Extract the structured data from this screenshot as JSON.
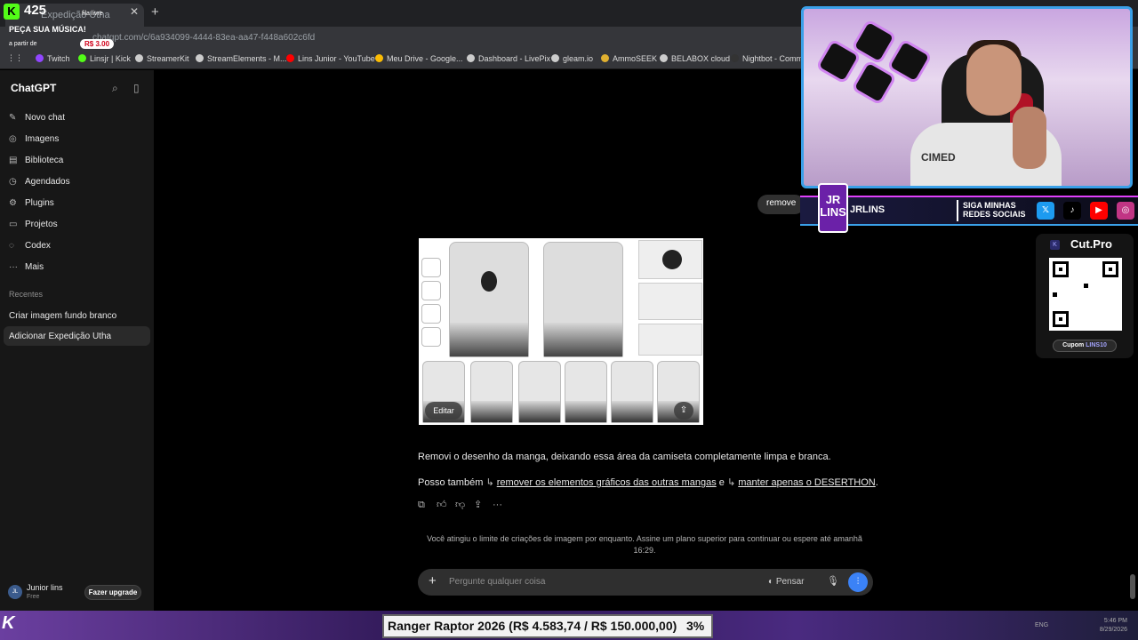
{
  "browser": {
    "tab_title": "Expedição Utha",
    "url": "chatgpt.com/c/6a934099-4444-83ea-aa47-f448a602c6fd",
    "bookmarks": [
      {
        "label": "Twitch",
        "color": "#9146ff"
      },
      {
        "label": "Linsjr | Kick",
        "color": "#53fc18"
      },
      {
        "label": "StreamerKit",
        "color": "#cccccc"
      },
      {
        "label": "StreamElements - M...",
        "color": "#cccccc"
      },
      {
        "label": "Lins Junior - YouTube",
        "color": "#ff0000"
      },
      {
        "label": "Meu Drive - Google...",
        "color": "#fbbc04"
      },
      {
        "label": "Dashboard - LivePix",
        "color": "#cccccc"
      },
      {
        "label": "gleam.io",
        "color": "#cccccc"
      },
      {
        "label": "AmmoSEEK",
        "color": "#e0b030"
      },
      {
        "label": "BELABOX cloud",
        "color": "#cccccc"
      },
      {
        "label": "Nightbot - Comm...",
        "color": "#333333"
      }
    ]
  },
  "overlay": {
    "count": "425",
    "fila": "fila livre",
    "peca": "PEÇA SUA MÚSICA!",
    "a_partir": "a partir de",
    "price": "R$ 3.00"
  },
  "sidebar": {
    "brand": "ChatGPT",
    "nav": [
      {
        "label": "Novo chat",
        "icon": "✎"
      },
      {
        "label": "Imagens",
        "icon": "◎"
      },
      {
        "label": "Biblioteca",
        "icon": "▤"
      },
      {
        "label": "Agendados",
        "icon": "◷"
      },
      {
        "label": "Plugins",
        "icon": "⚙"
      },
      {
        "label": "Projetos",
        "icon": "▭"
      },
      {
        "label": "Codex",
        "icon": "◌"
      },
      {
        "label": "Mais",
        "icon": "···"
      }
    ],
    "recentes_label": "Recentes",
    "recents": [
      "Criar imagem fundo branco",
      "Adicionar Expedição Utha"
    ],
    "user": {
      "initials": "JL",
      "name": "Junior lins",
      "plan": "Free",
      "upgrade": "Fazer upgrade"
    }
  },
  "chat": {
    "user_message": "remove",
    "image_edit_label": "Editar",
    "reply_line1": "Removi o desenho da manga, deixando essa área da camiseta completamente limpa e branca.",
    "reply_line2_prefix": "Posso também",
    "reply_link1": "remover os elementos gráficos das outras mangas",
    "reply_and": "e",
    "reply_link2": "manter apenas o DESERTHON",
    "limit_notice": "Você atingiu o limite de criações de imagem por enquanto. Assine um plano superior para continuar ou espere até amanhã 16:29.",
    "composer_placeholder": "Pergunte qualquer coisa",
    "think_label": "Pensar"
  },
  "webcam": {
    "shirt_text": "CIMED"
  },
  "social": {
    "name": "JRLINS",
    "cta": "SIGA MINHAS REDES SOCIAIS",
    "logo": "JR LINS"
  },
  "cutpro": {
    "brand": "Cut.Pro",
    "coupon_label": "Cupom",
    "coupon_code": "LINS10"
  },
  "goal": {
    "text": "Ranger Raptor 2026 (R$ 4.583,74 / R$ 150.000,00)",
    "percent": "3%"
  },
  "tray": {
    "lang": "ENG",
    "time": "5:46 PM",
    "date": "8/29/2026"
  }
}
